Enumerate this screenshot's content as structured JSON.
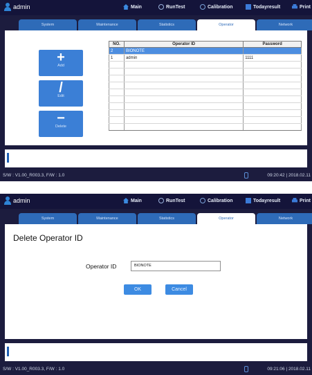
{
  "header": {
    "user": "admin",
    "nav": [
      "Main",
      "RunTest",
      "Calibration",
      "Todayresult",
      "Print"
    ]
  },
  "tabs": [
    "System",
    "Maintenance",
    "Statistics",
    "Operator",
    "Network"
  ],
  "active_tab": "Operator",
  "screen1": {
    "buttons": {
      "add": "Add",
      "edit": "Edit",
      "delete": "Delete"
    },
    "table": {
      "headers": [
        "NO.",
        "Operator ID",
        "Password"
      ],
      "rows": [
        [
          "2",
          "BIONOTE",
          ""
        ],
        [
          "1",
          "admin",
          "1111"
        ]
      ]
    },
    "status": {
      "version": "S/W : V1.00_R003.3, F/W : 1.0",
      "datetime": "09:20:42 | 2018.02.11"
    }
  },
  "screen2": {
    "dialog_title": "Delete Operator ID",
    "field_label": "Operator ID",
    "field_value": "BIONOTE",
    "ok_label": "OK",
    "cancel_label": "Cancel",
    "status": {
      "version": "S/W : V1.00_R003.3, F/W : 1.0",
      "datetime": "09:21:06 | 2018.02.11"
    }
  },
  "colors": {
    "frame": "#1c1c3e",
    "tab": "#2e6bb8",
    "button": "#3b7fd6",
    "selected_row": "#4d8ee0"
  }
}
